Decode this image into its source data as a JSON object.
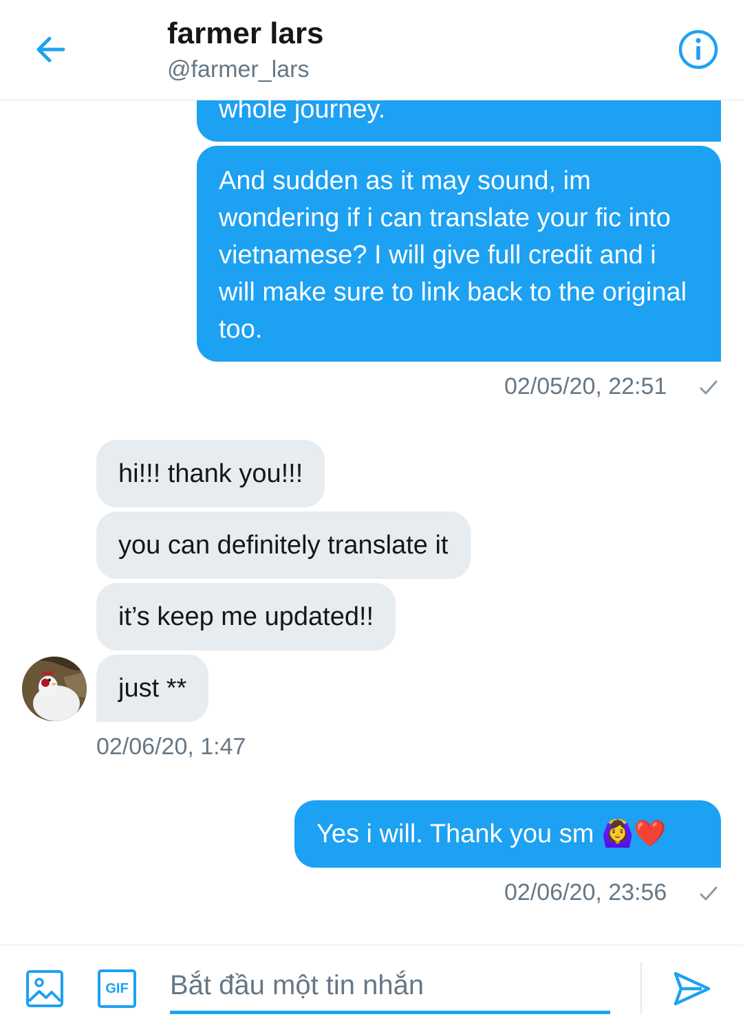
{
  "header": {
    "title": "farmer lars",
    "handle": "@farmer_lars"
  },
  "messages": {
    "out_partial": "whole journey.",
    "out_long": "And sudden as it may sound, im wondering if i can translate your fic into vietnamese? I will give full credit and i will make sure to link back to the original too.",
    "out_long_time": "02/05/20, 22:51",
    "in_1": "hi!!! thank you!!!",
    "in_2": "you can definitely translate it",
    "in_3": "it’s keep me updated!!",
    "in_4": "just **",
    "in_time": "02/06/20, 1:47",
    "out_reply": "Yes i will. Thank you sm 🙆‍♀️❤️",
    "out_reply_time": "02/06/20, 23:56"
  },
  "composer": {
    "placeholder": "Bắt đầu một tin nhắn",
    "gif_label": "GIF"
  },
  "icons": {
    "back": "arrow-left-icon",
    "info": "info-icon",
    "image": "image-icon",
    "gif": "gif-icon",
    "send": "send-icon",
    "read": "checkmark-icon"
  },
  "colors": {
    "accent": "#1da1f2",
    "incoming_bubble": "#e6ecf0",
    "secondary_text": "#657786"
  }
}
